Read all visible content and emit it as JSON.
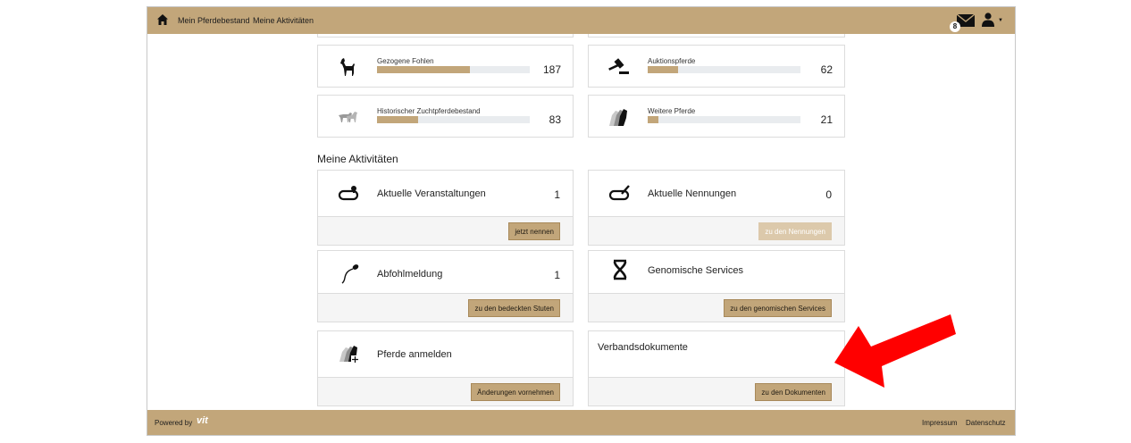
{
  "header": {
    "nav": [
      "Mein Pferdebestand",
      "Meine Aktivitäten"
    ],
    "mail_count": "8",
    "icons": {
      "home": "home-icon",
      "mail": "envelope-icon",
      "user": "user-icon"
    }
  },
  "stats": [
    {
      "label": "Gezogene Fohlen",
      "value": "187",
      "progress": 0.61,
      "icon": "foal-icon"
    },
    {
      "label": "Auktionspferde",
      "value": "62",
      "progress": 0.2,
      "icon": "auction-gavel-icon"
    },
    {
      "label": "Historischer Zuchtpferdebestand",
      "value": "83",
      "progress": 0.27,
      "icon": "historic-horses-icon"
    },
    {
      "label": "Weitere Pferde",
      "value": "21",
      "progress": 0.07,
      "icon": "horse-heads-icon"
    }
  ],
  "activities": {
    "title": "Meine Aktivitäten",
    "cards": [
      {
        "label": "Aktuelle Veranstaltungen",
        "value": "1",
        "button": "jetzt nennen",
        "icon": "event-track-icon"
      },
      {
        "label": "Aktuelle Nennungen",
        "value": "0",
        "button": "zu den Nennungen",
        "icon": "nomination-track-icon"
      },
      {
        "label": "Abfohlmeldung",
        "value": "1",
        "button": "zu den bedeckten Stuten",
        "icon": "sperm-icon"
      },
      {
        "label": "Genomische Services",
        "button": "zu den genomischen Services",
        "icon": "dna-icon"
      },
      {
        "label": "Pferde anmelden",
        "button": "Änderungen vornehmen",
        "icon": "add-horse-icon"
      },
      {
        "label": "Verbandsdokumente",
        "button": "zu den Dokumenten"
      }
    ]
  },
  "footer": {
    "powered_by": "Powered by",
    "logo": "vit",
    "links": [
      "Impressum",
      "Datenschutz"
    ]
  },
  "colors": {
    "accent": "#c2a67a",
    "arrow": "#ff0000",
    "bar_track": "#e9ecef"
  }
}
